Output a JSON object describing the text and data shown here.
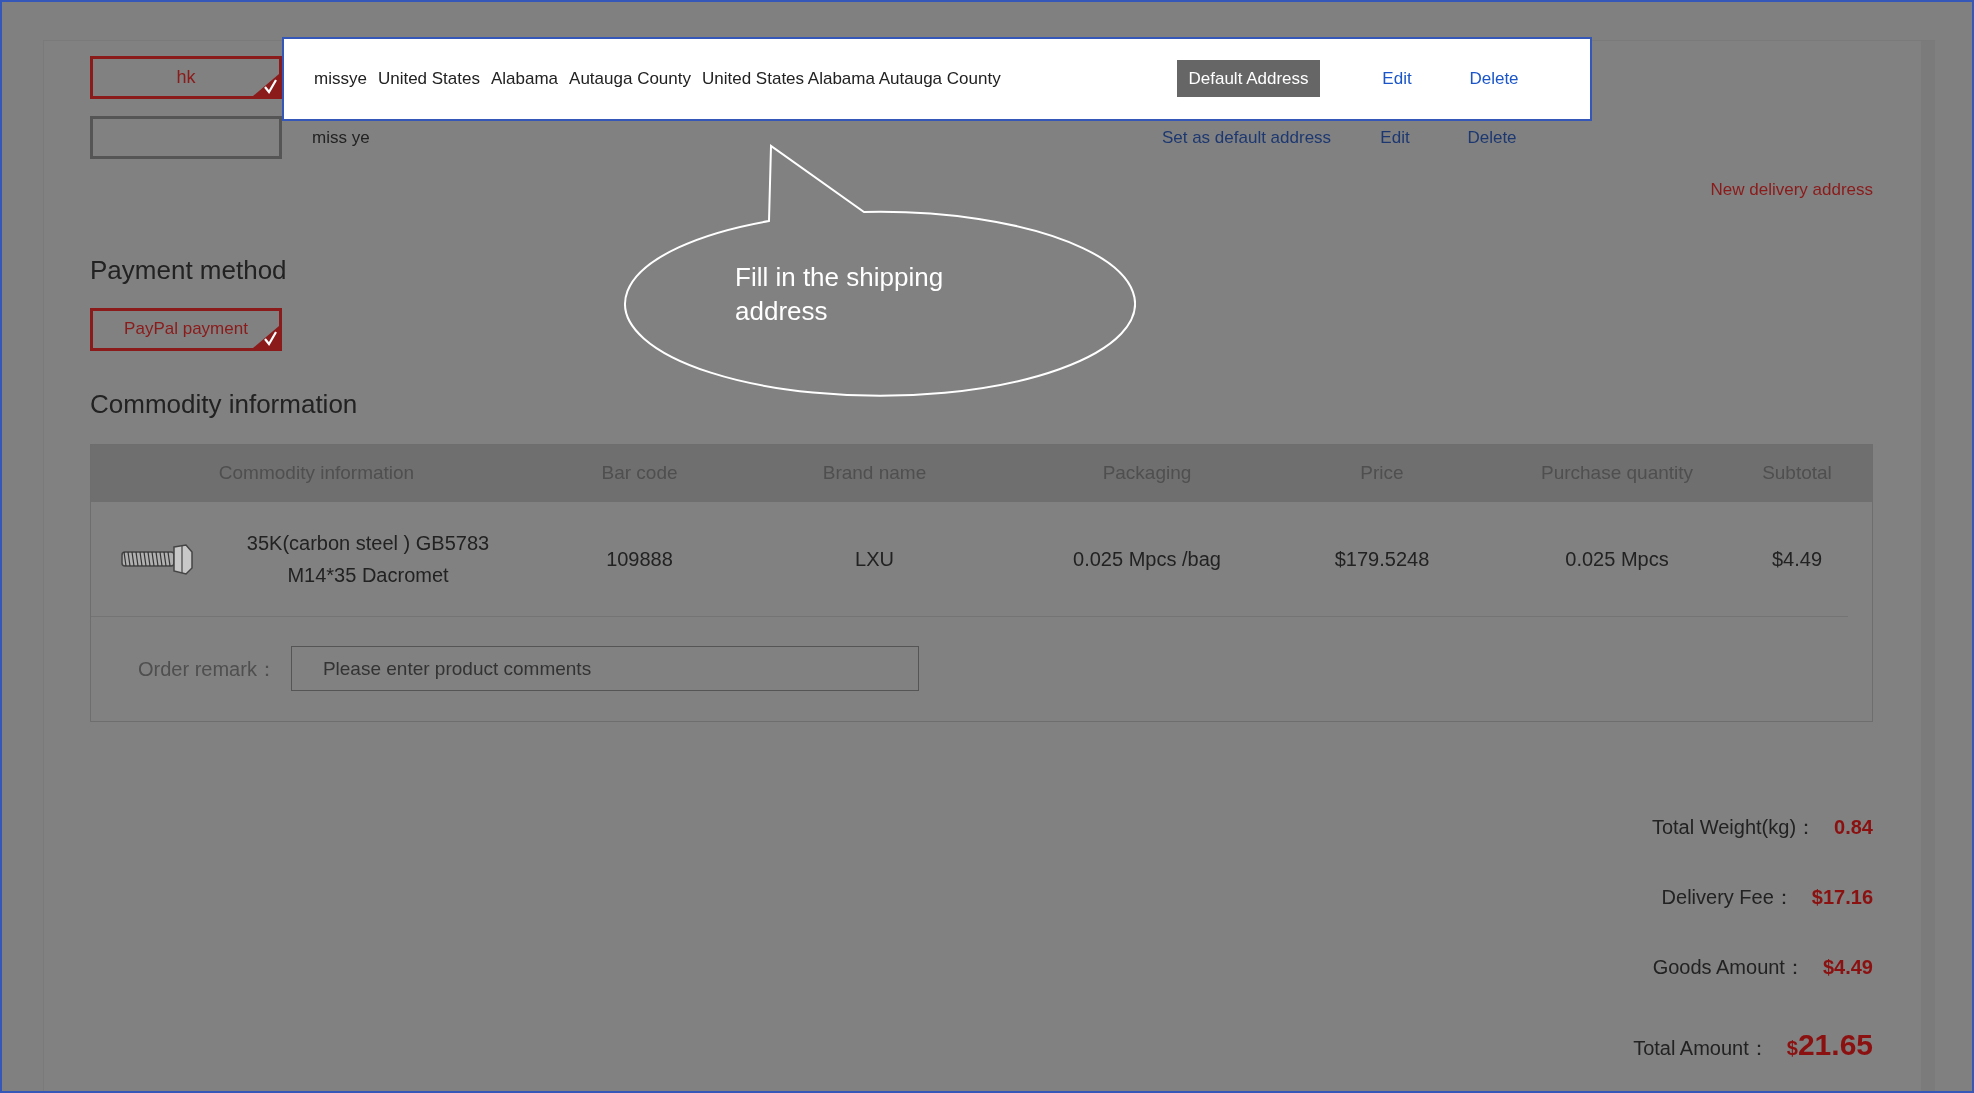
{
  "addresses": [
    {
      "tag": "hk",
      "selected": true,
      "highlighted": true,
      "name": "missye",
      "fields": [
        "United States",
        "Alabama",
        "Autauga County",
        "United States Alabama Autauga County"
      ],
      "is_default": true,
      "default_text": "Default Address",
      "actions": [
        "Edit",
        "Delete"
      ]
    },
    {
      "selected": false,
      "highlighted": false,
      "name": "miss ye",
      "is_default": false,
      "default_text": "Set as default address",
      "actions": [
        "Edit",
        "Delete"
      ]
    }
  ],
  "new_address_link": "New delivery address",
  "payment": {
    "title": "Payment method",
    "options": [
      {
        "label": "PayPal payment",
        "selected": true
      }
    ]
  },
  "commodity": {
    "title": "Commodity information",
    "columns": [
      "Commodity information",
      "Bar code",
      "Brand name",
      "Packaging",
      "Price",
      "Purchase quantity",
      "Subtotal"
    ],
    "rows": [
      {
        "name": "35K(carbon steel ) GB5783 M14*35 Dacromet",
        "bar_code": "109888",
        "brand": "LXU",
        "packaging": "0.025 Mpcs /bag",
        "price": "$179.5248",
        "quantity": "0.025 Mpcs",
        "subtotal": "$4.49"
      }
    ],
    "remark": {
      "label": "Order remark：",
      "placeholder": "Please enter product comments"
    }
  },
  "totals": [
    {
      "kind": "plain",
      "label": "Total Weight(kg)：",
      "value": "0.84"
    },
    {
      "kind": "plain",
      "label": "Delivery Fee：",
      "value": "$17.16"
    },
    {
      "kind": "plain",
      "label": "Goods Amount：",
      "value": "$4.49"
    },
    {
      "kind": "grand",
      "label": "Total Amount：",
      "currency": "$",
      "value": "21.65"
    }
  ],
  "callout": {
    "text": "Fill in the shipping address"
  }
}
